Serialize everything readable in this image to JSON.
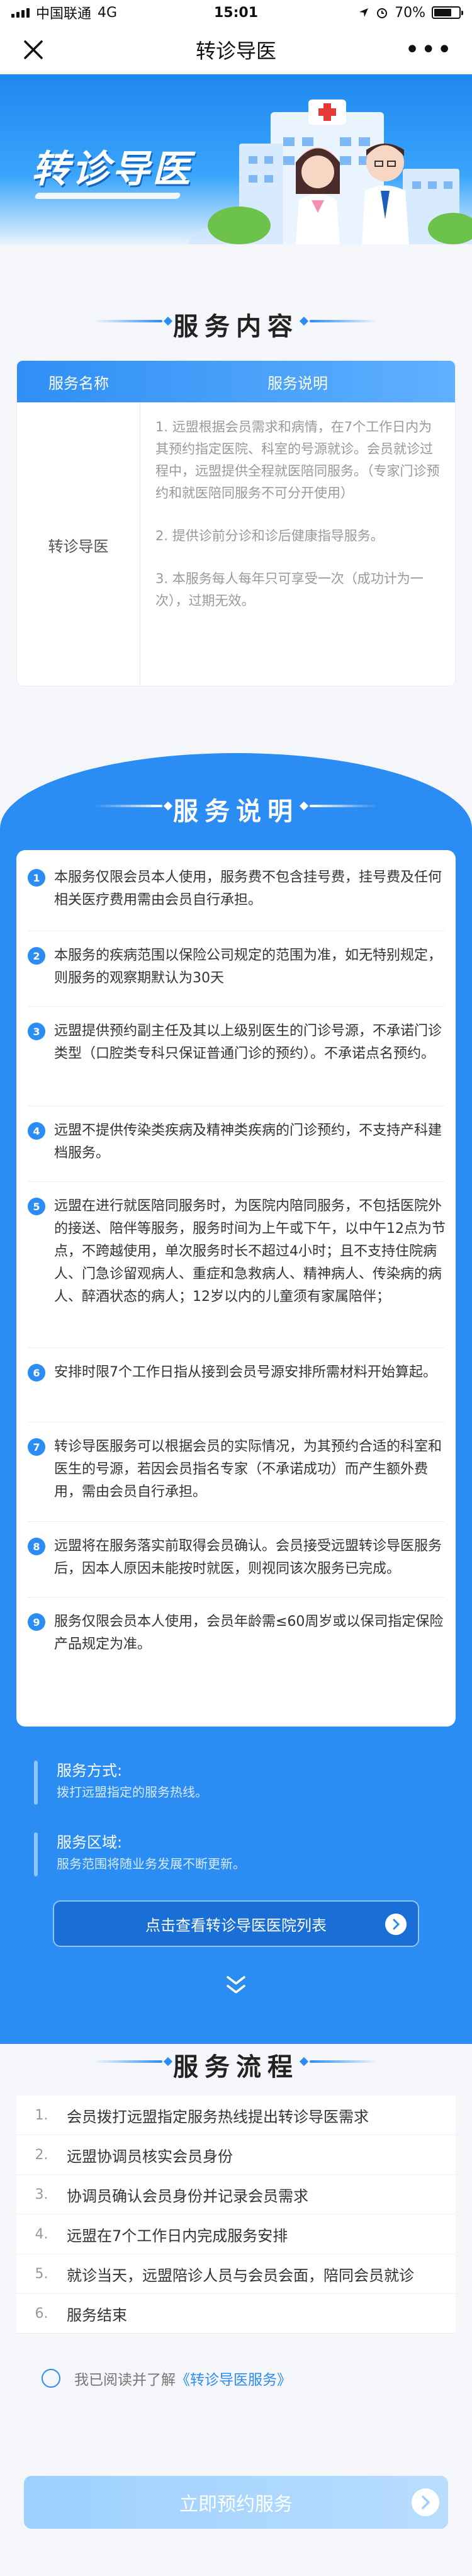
{
  "status_bar": {
    "carrier": "中国联通",
    "network": "4G",
    "time": "15:01",
    "battery": "70%",
    "battery_level": 0.7
  },
  "nav": {
    "title": "转诊导医"
  },
  "banner": {
    "title": "转诊导医"
  },
  "service_content": {
    "heading": "服务内容",
    "col_name": "服务名称",
    "col_desc": "服务说明",
    "name": "转诊导医",
    "desc": [
      "1. 远盟根据会员需求和病情，在7个工作日内为其预约指定医院、科室的号源就诊。会员就诊过程中，远盟提供全程就医陪同服务。（专家门诊预约和就医陪同服务不可分开使用）",
      "2. 提供诊前分诊和诊后健康指导服务。",
      "3. 本服务每人每年只可享受一次（成功计为一次），过期无效。"
    ]
  },
  "service_notes": {
    "heading": "服务说明",
    "items": [
      "本服务仅限会员本人使用，服务费不包含挂号费，挂号费及任何相关医疗费用需由会员自行承担。",
      "本服务的疾病范围以保险公司规定的范围为准，如无特别规定，则服务的观察期默认为30天",
      "远盟提供预约副主任及其以上级别医生的门诊号源，不承诺门诊类型（口腔类专科只保证普通门诊的预约）。不承诺点名预约。",
      "远盟不提供传染类疾病及精神类疾病的门诊预约，不支持产科建档服务。",
      "远盟在进行就医陪同服务时，为医院内陪同服务，不包括医院外的接送、陪伴等服务，服务时间为上午或下午，以中午12点为节点，不跨越使用，单次服务时长不超过4小时；且不支持住院病人、门急诊留观病人、重症和急救病人、精神病人、传染病的病人、醉酒状态的病人；12岁以内的儿童须有家属陪伴；",
      "安排时限7个工作日指从接到会员号源安排所需材料开始算起。",
      "转诊导医服务可以根据会员的实际情况，为其预约合适的科室和医生的号源，若因会员指名专家（不承诺成功）而产生额外费用，需由会员自行承担。",
      "远盟将在服务落实前取得会员确认。会员接受远盟转诊导医服务后，因本人原因未能按时就医，则视同该次服务已完成。",
      "服务仅限会员本人使用，会员年龄需≤60周岁或以保司指定保险产品规定为准。"
    ]
  },
  "service_method": {
    "label": "服务方式:",
    "value": "拨打远盟指定的服务热线。"
  },
  "service_area": {
    "label": "服务区域:",
    "value": "服务范围将随业务发展不断更新。"
  },
  "hospital_list_button": "点击查看转诊导医医院列表",
  "process": {
    "heading": "服务流程",
    "steps": [
      {
        "num": "1.",
        "text": "会员拨打远盟指定服务热线提出转诊导医需求"
      },
      {
        "num": "2.",
        "text": "远盟协调员核实会员身份"
      },
      {
        "num": "3.",
        "text": "协调员确认会员身份并记录会员需求"
      },
      {
        "num": "4.",
        "text": "远盟在7个工作日内完成服务安排"
      },
      {
        "num": "5.",
        "text": "就诊当天，远盟陪诊人员与会员会面，陪同会员就诊"
      },
      {
        "num": "6.",
        "text": "服务结束"
      }
    ]
  },
  "agreement": {
    "prefix": "我已阅读并了解",
    "link": "《转诊导医服务》"
  },
  "book_button": "立即预约服务",
  "colors": {
    "primary": "#2b8cf4",
    "banner_top": "#1e88f0",
    "book_button": "#9dd0ff"
  }
}
